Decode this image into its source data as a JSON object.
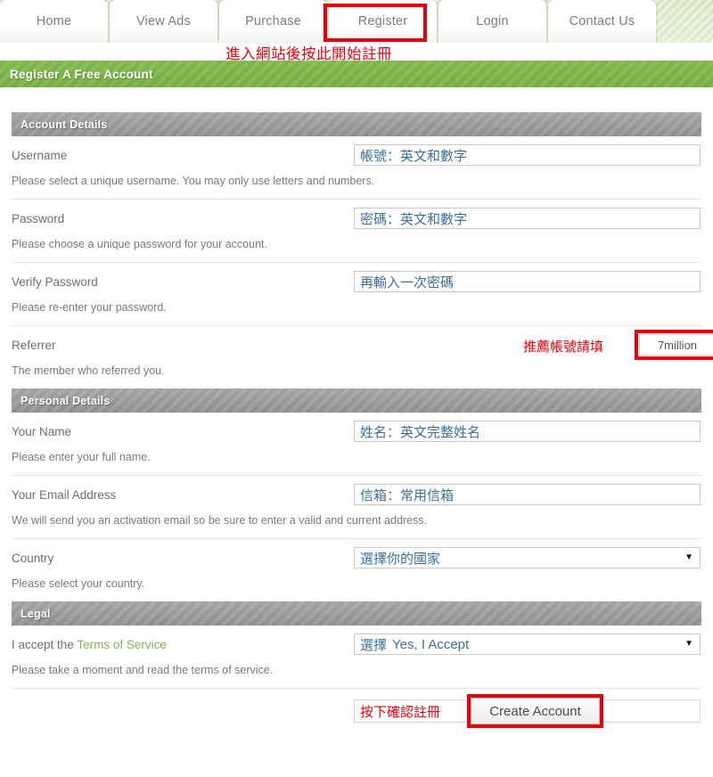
{
  "nav": {
    "tabs": [
      {
        "label": "Home",
        "active": false
      },
      {
        "label": "View Ads",
        "active": false
      },
      {
        "label": "Purchase",
        "active": false
      },
      {
        "label": "Register",
        "active": true
      },
      {
        "label": "Login",
        "active": false
      },
      {
        "label": "Contact Us",
        "active": false
      }
    ]
  },
  "annotations": {
    "top": "進入網站後按此開始註冊",
    "referrer": "推薦帳號請填",
    "submit": "按下確認註冊",
    "color": "#e8000d"
  },
  "page": {
    "title": "Register A Free Account",
    "title_bar_color": "#7bb247"
  },
  "sections": [
    {
      "heading": "Account Details",
      "fields": [
        {
          "label": "Username",
          "hint": "Please select a unique username. You may only use letters and numbers.",
          "control": "text",
          "value": "帳號：英文和數字"
        },
        {
          "label": "Password",
          "hint": "Please choose a unique password for your account.",
          "control": "text",
          "value": "密碼：英文和數字"
        },
        {
          "label": "Verify Password",
          "hint": "Please re-enter your password.",
          "control": "text",
          "value": "再輸入一次密碼"
        },
        {
          "label": "Referrer",
          "hint": "The member who referred you.",
          "control": "referrer",
          "value": "7million"
        }
      ]
    },
    {
      "heading": "Personal Details",
      "fields": [
        {
          "label": "Your Name",
          "hint": "Please enter your full name.",
          "control": "text",
          "value": "姓名：英文完整姓名"
        },
        {
          "label": "Your Email Address",
          "hint": "We will send you an activation email so be sure to enter a valid and current address.",
          "control": "text",
          "value": "信箱：常用信箱"
        },
        {
          "label": "Country",
          "hint": "Please select your country.",
          "control": "select",
          "value": "選擇你的國家",
          "caret": "▼"
        }
      ]
    },
    {
      "heading": "Legal",
      "fields": [
        {
          "label_prefix": "I accept the ",
          "label_link": "Terms of Service",
          "hint": "Please take a moment and read the terms of service.",
          "control": "select",
          "value_prefix": "選擇",
          "value": "Yes, I Accept",
          "caret": "▼"
        }
      ]
    }
  ],
  "submit": {
    "button_label": "Create Account"
  }
}
